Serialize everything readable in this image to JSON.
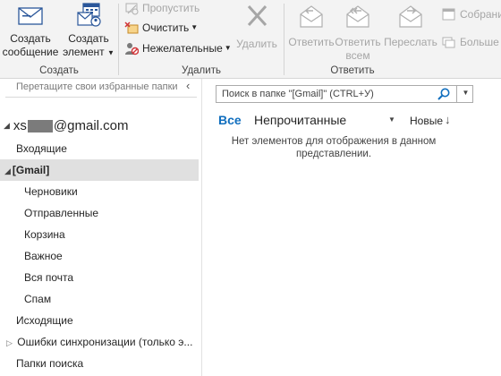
{
  "ribbon": {
    "groups": {
      "new": "Создать",
      "delete": "Удалить",
      "respond": "Ответить"
    },
    "new_message": [
      "Создать",
      "сообщение"
    ],
    "new_item": [
      "Создать",
      "элемент"
    ],
    "ignore": "Пропустить",
    "clean_up": "Очистить",
    "junk": "Нежелательные",
    "delete": "Удалить",
    "reply": "Ответить",
    "reply_all": [
      "Ответить",
      "всем"
    ],
    "forward": "Переслать",
    "meeting": "Собрани",
    "more": "Больше"
  },
  "folder_pane": {
    "favorites_hint": "Перетащите свои избранные папки",
    "account_prefix": "xs",
    "account_suffix": "@gmail.com",
    "folders": [
      "Входящие",
      "[Gmail]",
      "Черновики",
      "Отправленные",
      "Корзина",
      "Важное",
      "Вся почта",
      "Спам",
      "Исходящие",
      "Ошибки синхронизации (только э...",
      "Папки поиска"
    ]
  },
  "message_list": {
    "search_placeholder": "Поиск в папке \"[Gmail]\" (CTRL+У)",
    "filter_all": "Все",
    "filter_unread": "Непрочитанные",
    "sort_label": "Новые",
    "empty_text": "Нет элементов для отображения в данном представлении."
  },
  "icons": {
    "new_message": "envelope-icon",
    "new_item": "calendar-items-icon",
    "ignore": "ignore-icon",
    "clean_up": "cleanup-icon",
    "junk": "junk-icon",
    "delete": "delete-x-icon",
    "reply": "reply-icon",
    "reply_all": "reply-all-icon",
    "forward": "forward-icon",
    "search": "search-icon"
  },
  "colors": {
    "accent": "#106ebe",
    "selected_folder": "#e0e0e0",
    "ribbon_bg": "#f3f3f3"
  }
}
